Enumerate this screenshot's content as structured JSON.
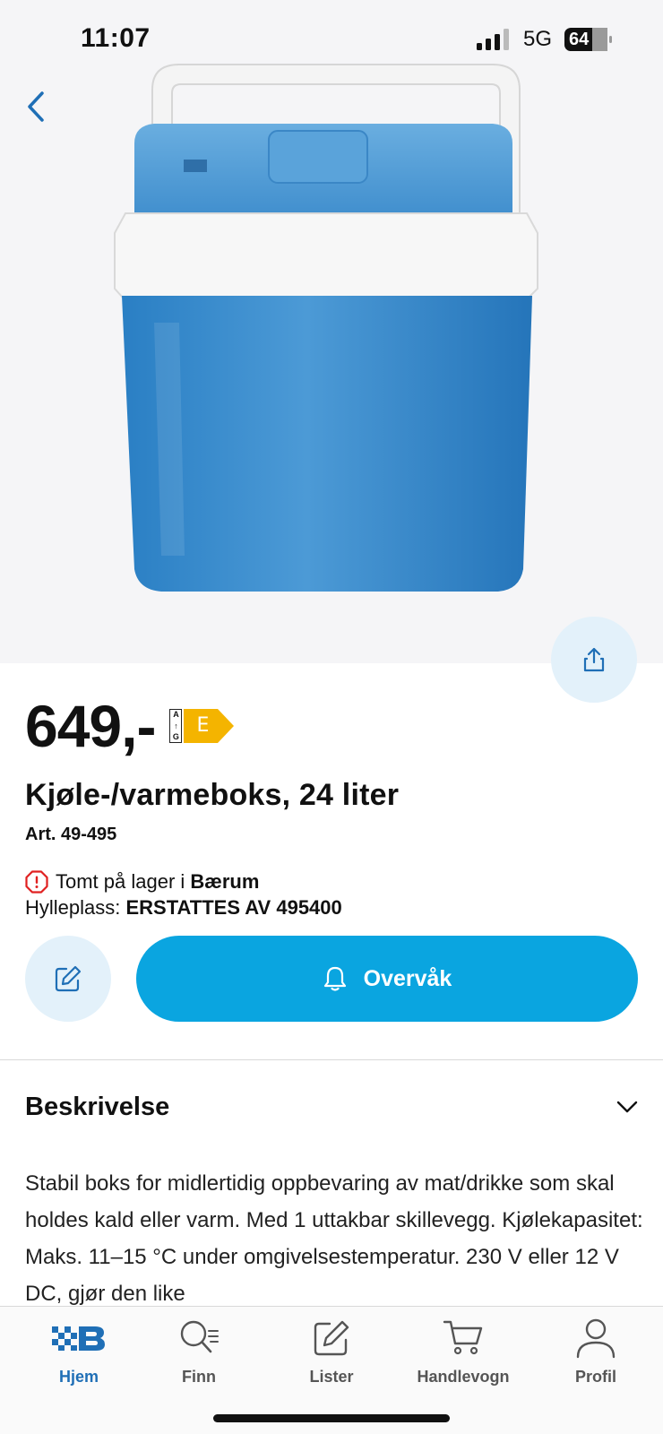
{
  "status_bar": {
    "time": "11:07",
    "network": "5G",
    "battery": "64"
  },
  "colors": {
    "accent": "#0aa5e0",
    "accent_light": "#e3f1fa",
    "brand": "#1f6fb6",
    "warning": "#e02020",
    "energy": "#f4b400"
  },
  "product": {
    "price": "649,-",
    "energy_scale_top": "A",
    "energy_scale_bottom": "G",
    "energy_class": "E",
    "title": "Kjøle-/varmeboks, 24 liter",
    "article": "Art. 49-495",
    "stock_text": "Tomt på lager i ",
    "stock_store": "Bærum",
    "shelf_label": "Hylleplass: ",
    "shelf_value": "ERSTATTES AV 495400"
  },
  "actions": {
    "watch_label": "Overvåk"
  },
  "description": {
    "title": "Beskrivelse",
    "text": "Stabil boks for midlertidig oppbevaring av mat/drikke som skal holdes kald eller varm. Med 1 uttakbar skillevegg. Kjølekapasitet: Maks. 11–15 °C under omgivelsestemperatur. 230 V eller 12 V DC, gjør den like"
  },
  "tabbar": {
    "items": [
      {
        "label": "Hjem",
        "icon": "brand-logo-icon",
        "active": true
      },
      {
        "label": "Finn",
        "icon": "search-list-icon",
        "active": false
      },
      {
        "label": "Lister",
        "icon": "edit-list-icon",
        "active": false
      },
      {
        "label": "Handlevogn",
        "icon": "cart-icon",
        "active": false
      },
      {
        "label": "Profil",
        "icon": "user-icon",
        "active": false
      }
    ]
  }
}
